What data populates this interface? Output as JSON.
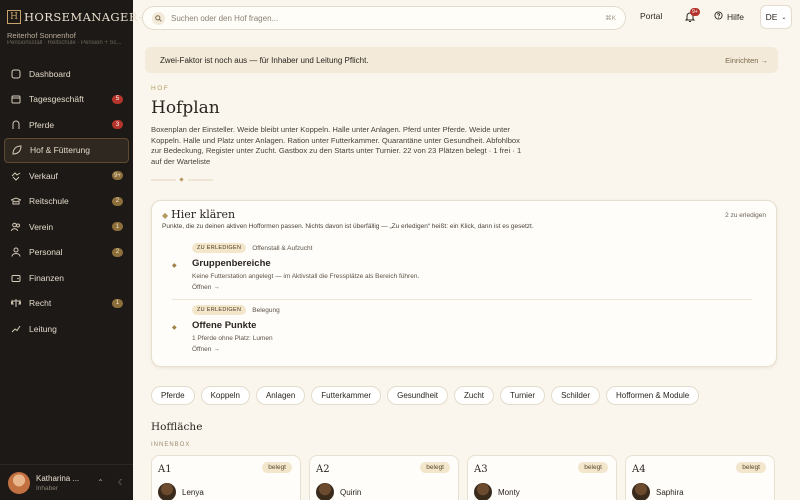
{
  "sidebar": {
    "brand_mark": "H",
    "brand_name": "HORSEMANAGER+",
    "farm_name": "Reiterhof Sonnenhof",
    "farm_tags": "Pensionsstall · Reitschule · Pension + Sc...",
    "items": [
      {
        "label": "Dashboard",
        "icon": "dashboard-icon",
        "badge": ""
      },
      {
        "label": "Tagesgeschäft",
        "icon": "calendar-icon",
        "badge": "5",
        "badge_type": "red"
      },
      {
        "label": "Pferde",
        "icon": "horseshoe-icon",
        "badge": "3",
        "badge_type": "red"
      },
      {
        "label": "Hof & Fütterung",
        "icon": "leaf-icon",
        "badge": "",
        "active": true
      },
      {
        "label": "Verkauf",
        "icon": "handshake-icon",
        "badge": "9+",
        "badge_type": "gold"
      },
      {
        "label": "Reitschule",
        "icon": "graduation-icon",
        "badge": "2",
        "badge_type": "gold"
      },
      {
        "label": "Verein",
        "icon": "users-icon",
        "badge": "1",
        "badge_type": "gold"
      },
      {
        "label": "Personal",
        "icon": "person-icon",
        "badge": "2",
        "badge_type": "gold"
      },
      {
        "label": "Finanzen",
        "icon": "wallet-icon",
        "badge": ""
      },
      {
        "label": "Recht",
        "icon": "scale-icon",
        "badge": "1",
        "badge_type": "gold"
      },
      {
        "label": "Leitung",
        "icon": "chart-icon",
        "badge": ""
      }
    ],
    "user": {
      "name": "Katharina ...",
      "role": "Inhaber"
    }
  },
  "topbar": {
    "search_placeholder": "Suchen oder den Hof fragen...",
    "search_shortcut": "⌘K",
    "portal_label": "Portal",
    "notification_count": "9+",
    "help_label": "Hilfe",
    "language": "DE"
  },
  "banner": {
    "text": "Zwei-Faktor ist noch aus — für Inhaber und Leitung Pflicht.",
    "action": "Einrichten →"
  },
  "header": {
    "eyebrow": "HOF",
    "title": "Hofplan",
    "description": "Boxenplan der Einsteller. Weide bleibt unter Koppeln. Halle unter Anlagen. Pferd unter Pferde. Weide unter Koppeln. Halle und Platz unter Anlagen. Ration unter Futterkammer. Quarantäne unter Gesundheit. Abfohlbox zur Bedeckung, Register unter Zucht. Gastbox zu den Starts unter Turnier. 22 von 23 Plätzen belegt · 1 frei · 1 auf der Warteliste"
  },
  "clarify": {
    "title": "Hier klären",
    "count": "2 zu erledigen",
    "subtitle": "Punkte, die zu deinen aktiven Hofformen passen. Nichts davon ist überfällig — „Zu erledigen“ heißt: ein Klick, dann ist es gesetzt.",
    "tasks": [
      {
        "status": "ZU ERLEDIGEN",
        "category": "Offenstall & Aufzucht",
        "title": "Gruppenbereiche",
        "description": "Keine Futterstation angelegt — im Aktivstall die Fressplätze als Bereich führen.",
        "action": "Öffnen →"
      },
      {
        "status": "ZU ERLEDIGEN",
        "category": "Belegung",
        "title": "Offene Punkte",
        "description": "1 Pferde ohne Platz: Lumen",
        "action": "Öffnen →"
      }
    ]
  },
  "filters": [
    "Pferde",
    "Koppeln",
    "Anlagen",
    "Futterkammer",
    "Gesundheit",
    "Zucht",
    "Turnier",
    "Schilder",
    "Hofformen & Module"
  ],
  "section": {
    "title": "Hoffläche",
    "subtitle": "INNENBOX"
  },
  "boxes": [
    {
      "name": "A1",
      "status": "belegt",
      "horse": "Lenya"
    },
    {
      "name": "A2",
      "status": "belegt",
      "horse": "Quirin"
    },
    {
      "name": "A3",
      "status": "belegt",
      "horse": "Monty"
    },
    {
      "name": "A4",
      "status": "belegt",
      "horse": "Saphira"
    }
  ],
  "colors": {
    "sidebar_bg": "#1c1916",
    "accent_gold": "#b3995e",
    "badge_red": "#b5352c",
    "page_bg": "#faf6ee"
  }
}
